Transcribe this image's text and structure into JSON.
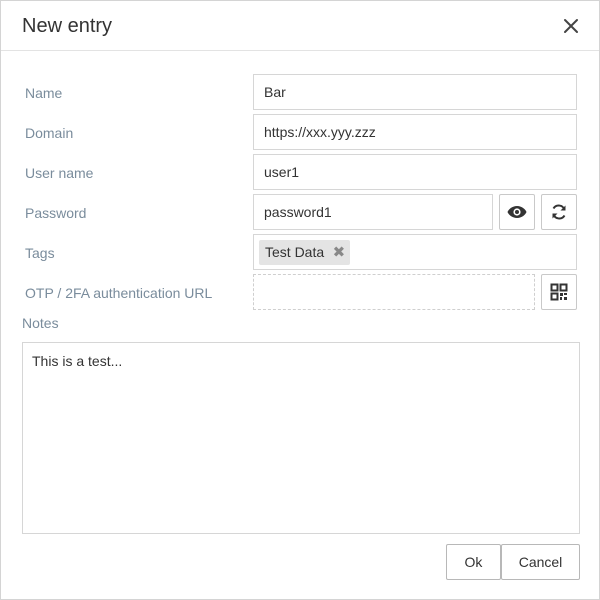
{
  "dialog": {
    "title": "New entry",
    "close_icon": "close-icon"
  },
  "fields": {
    "name": {
      "label": "Name",
      "value": "Bar"
    },
    "domain": {
      "label": "Domain",
      "value": "https://xxx.yyy.zzz"
    },
    "user_name": {
      "label": "User name",
      "value": "user1"
    },
    "password": {
      "label": "Password",
      "value": "password1",
      "show_icon": "eye-icon",
      "generate_icon": "refresh-icon"
    },
    "tags": {
      "label": "Tags",
      "items": [
        {
          "label": "Test Data",
          "remove_icon": "remove-x-icon"
        }
      ]
    },
    "otp": {
      "label": "OTP / 2FA authentication URL",
      "value": "",
      "scan_icon": "qr-code-icon"
    },
    "notes": {
      "label": "Notes",
      "value": "This is a test..."
    }
  },
  "buttons": {
    "ok": "Ok",
    "cancel": "Cancel"
  }
}
